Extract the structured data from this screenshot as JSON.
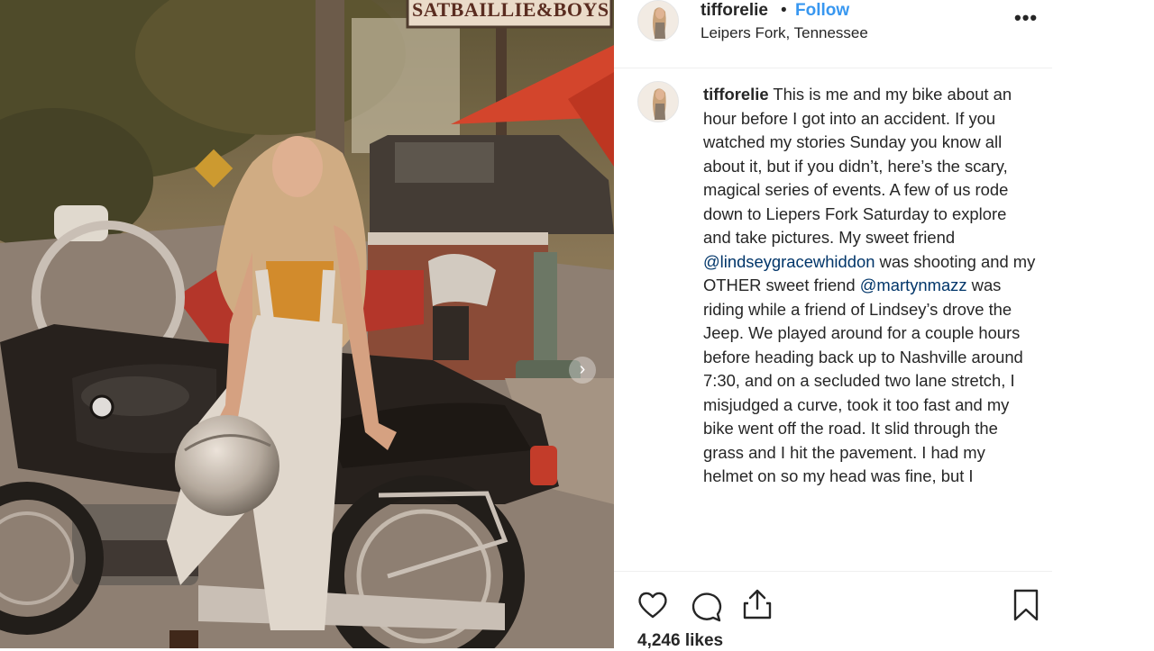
{
  "photo": {
    "sign_text": "SATBAILLIE&BOYS",
    "next_button": "›"
  },
  "post_header": {
    "username": "tiffore lie",
    "username_display": "tifforelie",
    "separator": "•",
    "follow_label": "Follow",
    "location": "Leipers Fork, Tennessee",
    "more_label": "•••"
  },
  "caption": {
    "username": "tifforelie",
    "text_1": "This is me and my bike about an hour before I got into an accident. If you watched my stories Sunday you know all about it, but if you didn’t, here’s the scary, magical series of events. A few of us rode down to Liepers Fork Saturday to explore and take pictures. My sweet friend ",
    "mention_1": "@lindseygracewhiddon",
    "text_2": " was shooting and my OTHER sweet friend ",
    "mention_2": "@martynmazz",
    "text_3": " was riding while a friend of Lindsey’s drove the Jeep. We played around for a couple hours before heading back up to Nashville around 7:30, and on a secluded two lane stretch, I misjudged a curve, took it too fast and my bike went off the road. It slid through the grass and I hit the pavement. I had my helmet on so my head was fine, but I"
  },
  "actions": {
    "like_icon": "heart-icon",
    "comment_icon": "comment-icon",
    "share_icon": "share-icon",
    "save_icon": "bookmark-icon"
  },
  "likes": "4,246 likes",
  "colors": {
    "link": "#3897f0",
    "mention": "#003569",
    "text": "#262626"
  }
}
